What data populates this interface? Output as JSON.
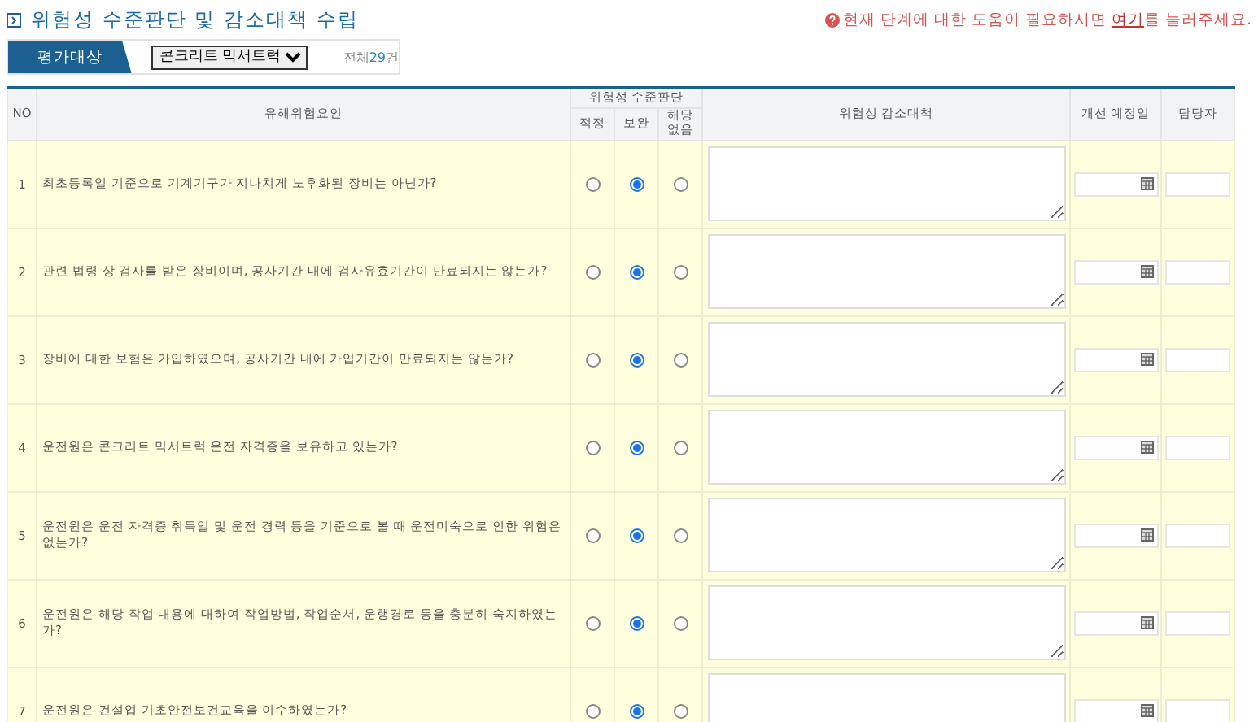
{
  "title": "위험성 수준판단 및 감소대책 수립",
  "help": {
    "before": "현재 단계에 대한 도움이 필요하시면 ",
    "link": "여기",
    "after": "를 눌러주세요."
  },
  "filter": {
    "label": "평가대상",
    "value": "콘크리트 믹서트럭",
    "count_prefix": "전체",
    "count_value": "29",
    "count_suffix": "건"
  },
  "table": {
    "columns": {
      "no": "NO",
      "factor": "유해위험요인",
      "judgment": "위험성 수준판단",
      "options": [
        "적정",
        "보완",
        "해당\n없음"
      ],
      "measures": "위험성 감소대책",
      "date": "개선 예정일",
      "owner": "담당자"
    },
    "rows": [
      {
        "no": "1",
        "factor": "최초등록일 기준으로 기계기구가 지나치게 노후화된 장비는 아닌가?",
        "ratings": [
          {
            "selected": false
          },
          {
            "selected": true
          },
          {
            "selected": false
          }
        ]
      },
      {
        "no": "2",
        "factor": "관련 법령 상 검사를 받은 장비이며, 공사기간 내에 검사유효기간이 만료되지는 않는가?",
        "ratings": [
          {
            "selected": false
          },
          {
            "selected": true
          },
          {
            "selected": false
          }
        ]
      },
      {
        "no": "3",
        "factor": "장비에 대한 보험은 가입하였으며, 공사기간 내에 가입기간이 만료되지는 않는가?",
        "ratings": [
          {
            "selected": false
          },
          {
            "selected": true
          },
          {
            "selected": false
          }
        ]
      },
      {
        "no": "4",
        "factor": "운전원은 콘크리트 믹서트럭 운전 자격증을 보유하고 있는가?",
        "ratings": [
          {
            "selected": false
          },
          {
            "selected": true
          },
          {
            "selected": false
          }
        ]
      },
      {
        "no": "5",
        "factor": "운전원은 운전 자격증 취득일 및 운전 경력 등을 기준으로 볼 때 운전미숙으로 인한 위험은 없는가?",
        "ratings": [
          {
            "selected": false
          },
          {
            "selected": true
          },
          {
            "selected": false
          }
        ]
      },
      {
        "no": "6",
        "factor": "운전원은 해당 작업 내용에 대하여 작업방법, 작업순서, 운행경로 등을 충분히 숙지하였는가?",
        "ratings": [
          {
            "selected": false
          },
          {
            "selected": true
          },
          {
            "selected": false
          }
        ]
      },
      {
        "no": "7",
        "factor": "운전원은 건설업 기초안전보건교육을 이수하였는가?",
        "ratings": [
          {
            "selected": false
          },
          {
            "selected": true
          },
          {
            "selected": false
          }
        ]
      }
    ]
  }
}
